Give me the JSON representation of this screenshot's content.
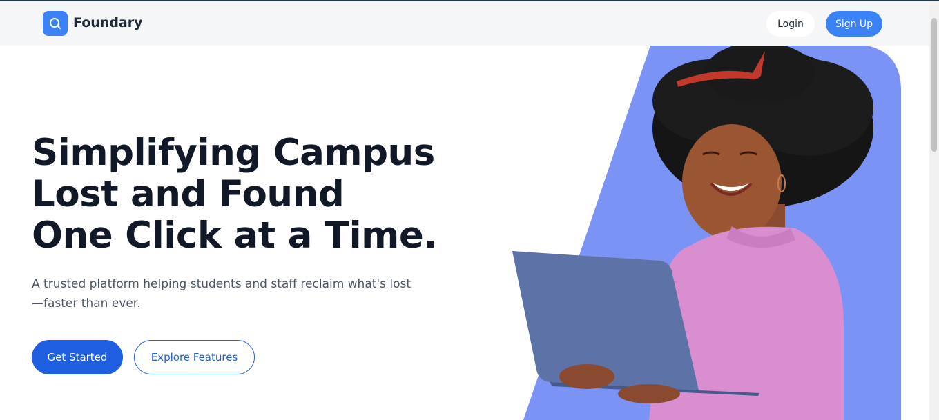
{
  "brand": {
    "name": "Foundary",
    "logo_icon": "search-icon",
    "accent": "#3b82f6"
  },
  "nav": {
    "login_label": "Login",
    "signup_label": "Sign Up"
  },
  "hero": {
    "title_lines": [
      "Simplifying Campus",
      "Lost and Found",
      "One Click at a Time."
    ],
    "subtitle": "A trusted platform helping students and staff reclaim what's lost—faster than ever.",
    "primary_cta": "Get Started",
    "secondary_cta": "Explore Features",
    "primary_color": "#1d5fe0",
    "illustration_bg": "#7b93f5"
  }
}
